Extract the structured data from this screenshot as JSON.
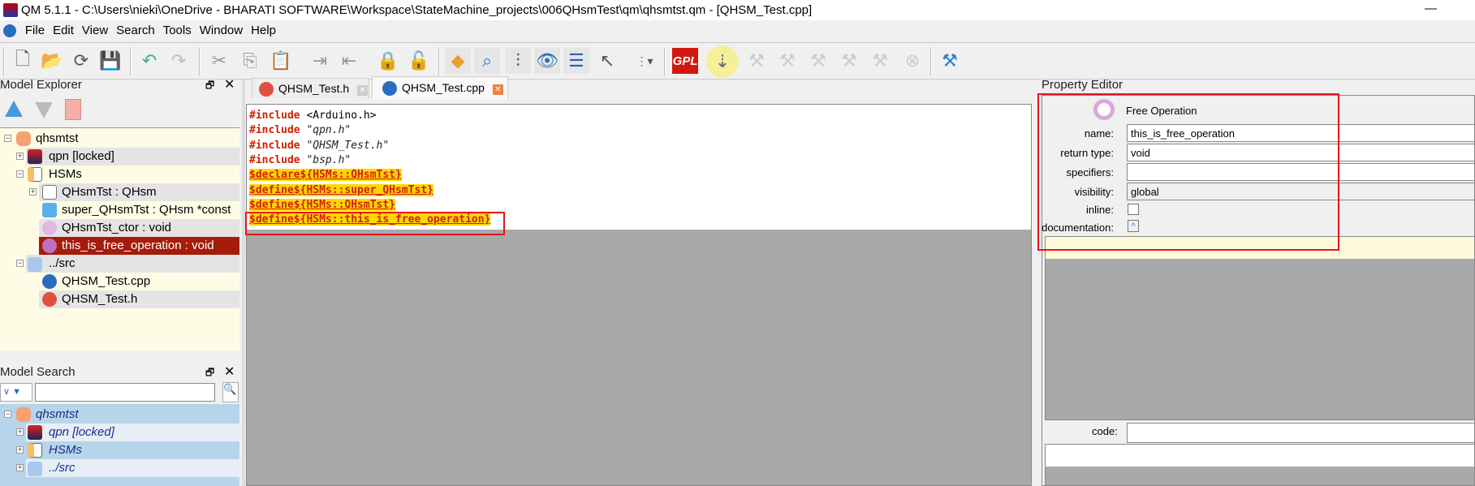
{
  "window": {
    "title": "QM 5.1.1 - C:\\Users\\nieki\\OneDrive - BHARATI SOFTWARE\\Workspace\\StateMachine_projects\\006QHsmTest\\qm\\qhsmtst.qm - [QHSM_Test.cpp]",
    "minimize": "—"
  },
  "menu": [
    "File",
    "Edit",
    "View",
    "Search",
    "Tools",
    "Window",
    "Help"
  ],
  "toolbar": {
    "gpl_label": "GPL"
  },
  "model_explorer": {
    "title": "Model Explorer",
    "items": [
      {
        "label": "qhsmtst",
        "icon": "database-icon"
      },
      {
        "label": "qpn [locked]",
        "icon": "qp-package-icon"
      },
      {
        "label": "HSMs",
        "icon": "package-folder-icon"
      },
      {
        "label": "QHsmTst : QHsm",
        "icon": "class-icon"
      },
      {
        "label": "super_QHsmTst : QHsm *const",
        "icon": "attribute-icon"
      },
      {
        "label": "QHsmTst_ctor : void",
        "icon": "operation-icon"
      },
      {
        "label": "this_is_free_operation : void",
        "icon": "operation-icon",
        "selected": true
      },
      {
        "label": "../src",
        "icon": "directory-icon"
      },
      {
        "label": "QHSM_Test.cpp",
        "icon": "cpp-file-icon"
      },
      {
        "label": "QHSM_Test.h",
        "icon": "h-file-icon"
      }
    ]
  },
  "model_search": {
    "title": "Model Search",
    "input_value": "",
    "items": [
      {
        "label": "qhsmtst"
      },
      {
        "label": "qpn [locked]"
      },
      {
        "label": "HSMs"
      },
      {
        "label": "../src"
      }
    ]
  },
  "editor": {
    "tabs": [
      {
        "label": "QHSM_Test.h",
        "active": false
      },
      {
        "label": "QHSM_Test.cpp",
        "active": true
      }
    ],
    "lines": [
      {
        "kw": "#include",
        "rest": " <Arduino.h>"
      },
      {
        "kw": "#include",
        "rest": " \"qpn.h\""
      },
      {
        "kw": "#include",
        "rest": " \"QHSM_Test.h\""
      },
      {
        "kw": "#include",
        "rest": " \"bsp.h\""
      },
      {
        "macro": "$declare${HSMs::QHsmTst}"
      },
      {
        "macro": "$define${HSMs::super_QHsmTst}"
      },
      {
        "macro": "$define${HSMs::QHsmTst}"
      },
      {
        "macro": "$define${HSMs::this_is_free_operation}"
      }
    ]
  },
  "property_editor": {
    "title": "Property Editor",
    "type": "Free Operation",
    "name_label": "name:",
    "name": "this_is_free_operation",
    "return_type_label": "return type:",
    "return_type": "void",
    "specifiers_label": "specifiers:",
    "specifiers": "",
    "visibility_label": "visibility:",
    "visibility": "global",
    "inline_label": "inline:",
    "inline": false,
    "documentation_label": "documentation:",
    "code_label": "code:",
    "code": ""
  },
  "colors": {
    "highlight_red": "#e8141c",
    "selected_row": "#a51c0b",
    "macro_bg": "#ffd700",
    "keyword": "#d02000"
  }
}
